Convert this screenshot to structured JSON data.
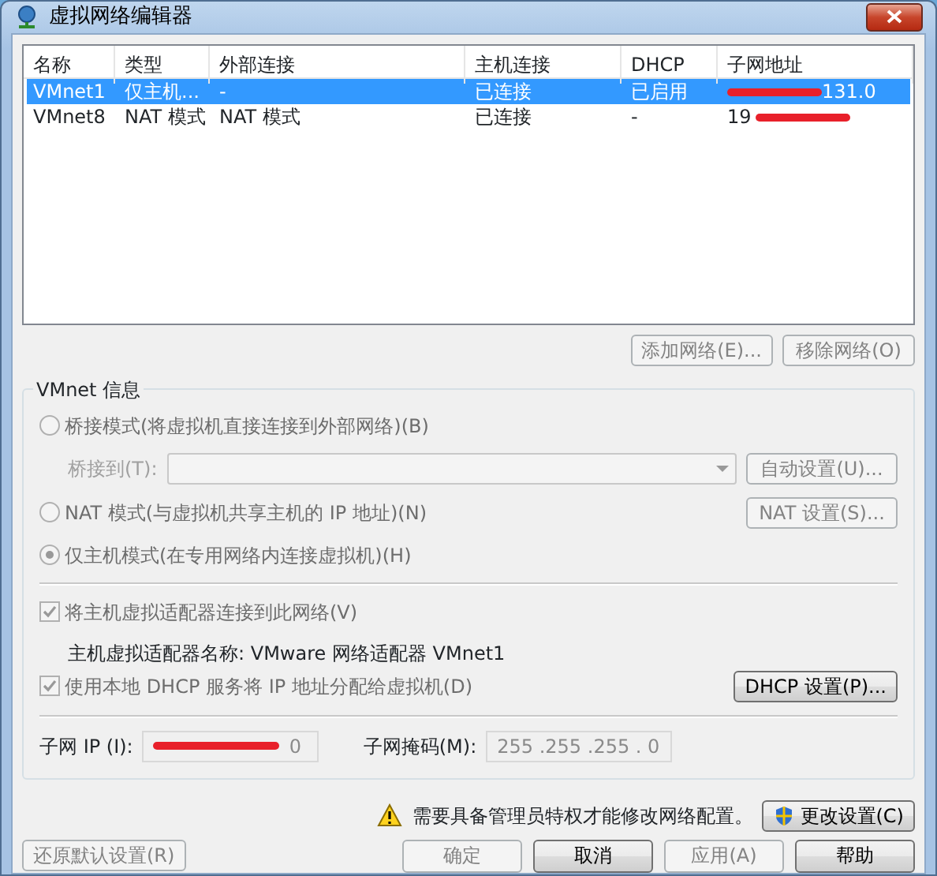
{
  "window": {
    "title": "虚拟网络编辑器"
  },
  "table": {
    "columns": [
      "名称",
      "类型",
      "外部连接",
      "主机连接",
      "DHCP",
      "子网地址"
    ],
    "rows": [
      {
        "cells": [
          "VMnet1",
          "仅主机...",
          "-",
          "已连接",
          "已启用",
          "131.0"
        ],
        "selected": true
      },
      {
        "cells": [
          "VMnet8",
          "NAT 模式",
          "NAT 模式",
          "已连接",
          "-",
          "19"
        ],
        "selected": false
      }
    ]
  },
  "list_buttons": [
    {
      "label": "添加网络(E)...",
      "disabled": true
    },
    {
      "label": "移除网络(O)",
      "disabled": true
    }
  ],
  "vmnet_info": {
    "title": "VMnet 信息",
    "bridged_mode": {
      "label": "桥接模式(将虚拟机直接连接到外部网络)(B)",
      "selected": false,
      "disabled": true
    },
    "bridge_to": {
      "label": "桥接到(T):",
      "disabled": true
    },
    "auto_settings_button": {
      "label": "自动设置(U)...",
      "disabled": true
    },
    "nat_mode": {
      "label": "NAT 模式(与虚拟机共享主机的 IP 地址)(N)",
      "selected": false,
      "disabled": true
    },
    "nat_settings_button": {
      "label": "NAT 设置(S)...",
      "disabled": true
    },
    "host_only_mode": {
      "label": "仅主机模式(在专用网络内连接虚拟机)(H)",
      "selected": true,
      "disabled": true
    },
    "connect_adapter": {
      "label": "将主机虚拟适配器连接到此网络(V)",
      "checked": true,
      "disabled": true
    },
    "adapter_name": "主机虚拟适配器名称: VMware 网络适配器 VMnet1",
    "use_dhcp": {
      "label": "使用本地 DHCP 服务将 IP 地址分配给虚拟机(D)",
      "checked": true,
      "disabled": true
    },
    "dhcp_settings_button": {
      "label": "DHCP 设置(P)...",
      "disabled": false
    },
    "subnet_ip": {
      "label": "子网 IP (I):",
      "value": "0"
    },
    "subnet_mask": {
      "label": "子网掩码(M):",
      "value": "255 .255 .255 . 0"
    }
  },
  "admin_notice": "需要具备管理员特权才能修改网络配置。",
  "change_settings_button": {
    "label": "更改设置(C)"
  },
  "buttons": [
    {
      "label": "还原默认设置(R)",
      "disabled": true
    },
    {
      "label": "确定",
      "disabled": true
    },
    {
      "label": "取消",
      "disabled": false
    },
    {
      "label": "应用(A)",
      "disabled": true
    },
    {
      "label": "帮助",
      "disabled": false
    }
  ]
}
